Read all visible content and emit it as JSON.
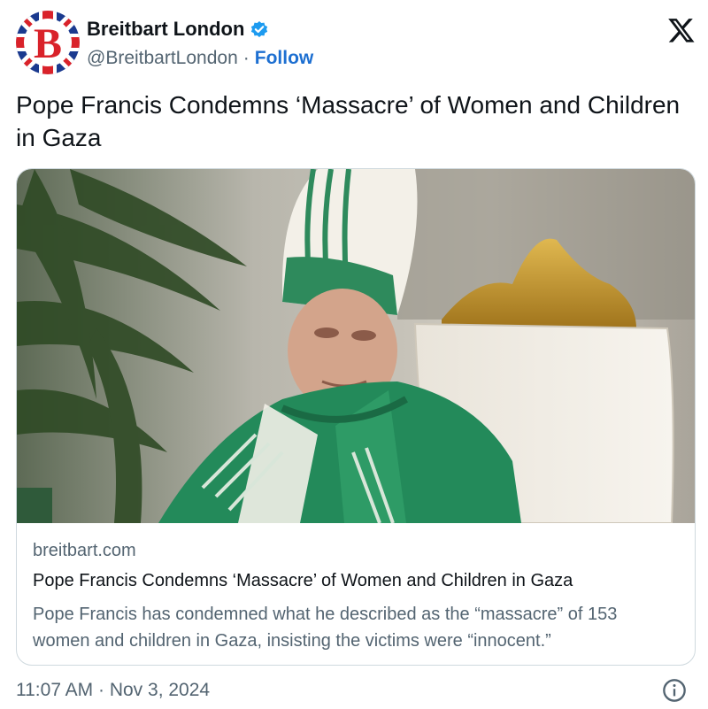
{
  "tweet": {
    "author": {
      "display_name": "Breitbart London",
      "handle": "@BreitbartLondon",
      "separator": "·",
      "follow_label": "Follow",
      "avatar_letter": "B",
      "avatar_icon": "union-flag-avatar-icon",
      "verified_icon": "verified-badge-icon"
    },
    "platform_icon": "x-logo-icon",
    "text": "Pope Francis Condemns ‘Massacre’ of Women and Children in Gaza",
    "card": {
      "image_icon": "pope-francis-photo",
      "domain": "breitbart.com",
      "title": "Pope Francis Condemns ‘Massacre’ of Women and Children in Gaza",
      "description": "Pope Francis has condemned what he described as the “massacre” of 153 women and children in Gaza, insisting the victims were “innocent.”"
    },
    "timestamp": "11:07 AM · Nov 3, 2024",
    "info_icon": "info-icon"
  },
  "colors": {
    "follow": "#1d6fd1",
    "secondary_text": "#536471",
    "primary_text": "#0f1419",
    "verified": "#1d9bf0",
    "breitbart_red": "#d9222a",
    "flag_blue": "#1b3a8f"
  }
}
